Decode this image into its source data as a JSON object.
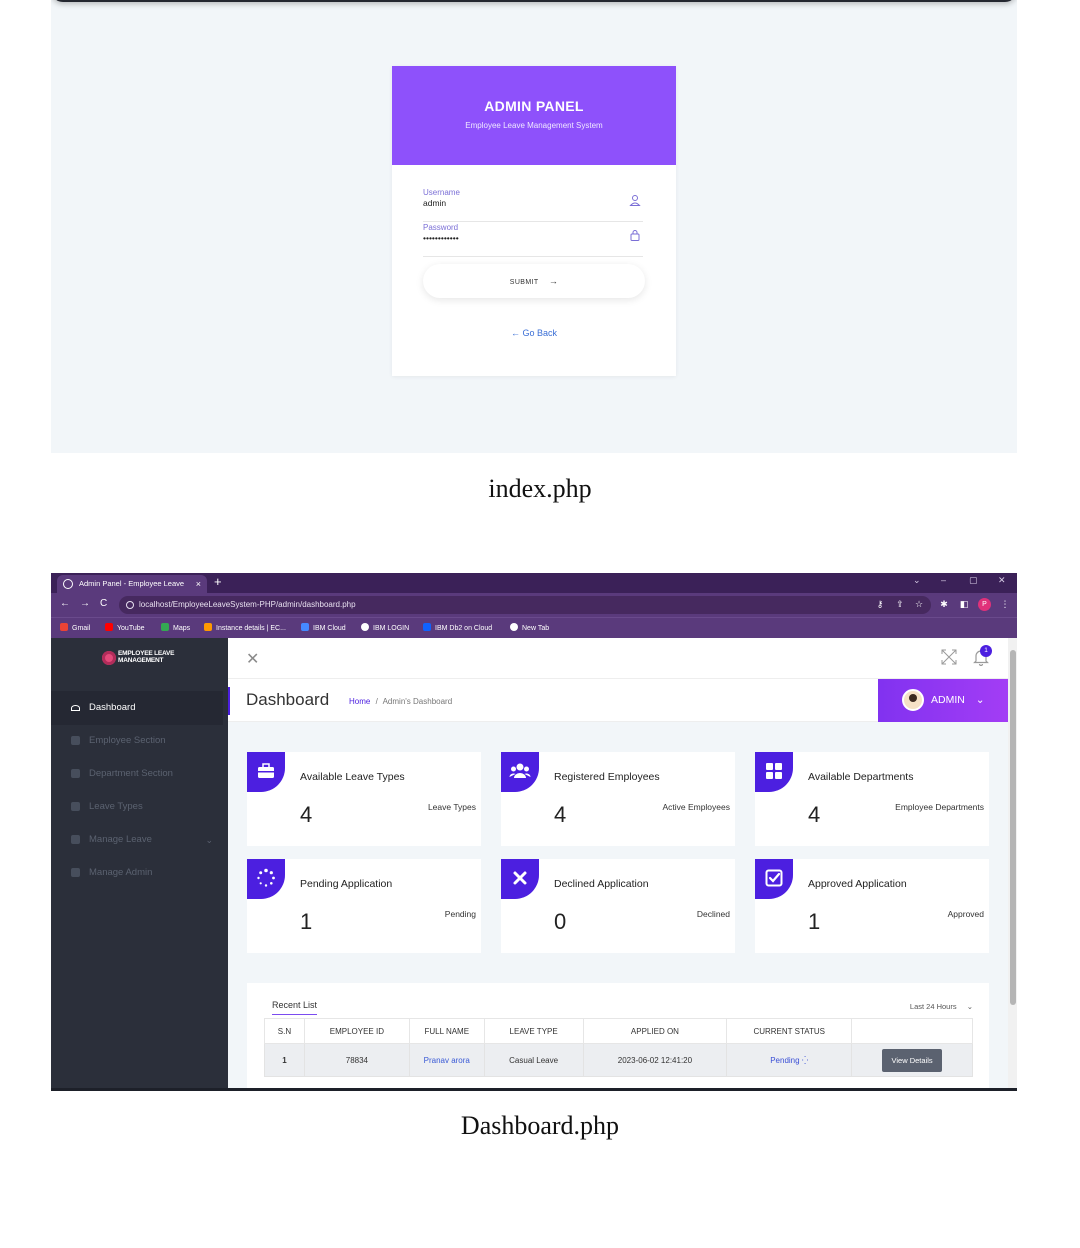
{
  "login": {
    "title": "ADMIN PANEL",
    "subtitle": "Employee Leave Management System",
    "username_label": "Username",
    "username_value": "admin",
    "password_label": "Password",
    "password_value": "••••••••••••",
    "submit_label": "SUBMIT",
    "go_back_label": "Go Back",
    "header_color": "#8e51fb"
  },
  "captions": {
    "first": "index.php",
    "second": "Dashboard.php"
  },
  "browser": {
    "tab_title": "Admin Panel - Employee Leave",
    "url": "localhost/EmployeeLeaveSystem-PHP/admin/dashboard.php",
    "profile_initial": "P",
    "bookmarks": [
      "Gmail",
      "YouTube",
      "Maps",
      "Instance details | EC...",
      "IBM Cloud",
      "IBM LOGIN",
      "IBM Db2 on Cloud",
      "New Tab"
    ],
    "theme_color": "#5a3a7c"
  },
  "sidebar": {
    "logo_line1": "EMPLOYEE LEAVE",
    "logo_line2": "MANAGEMENT",
    "items": [
      {
        "label": "Dashboard",
        "icon": "dashboard-icon",
        "active": true
      },
      {
        "label": "Employee Section",
        "icon": "id-card-icon"
      },
      {
        "label": "Department Section",
        "icon": "grid-icon"
      },
      {
        "label": "Leave Types",
        "icon": "leave-icon"
      },
      {
        "label": "Manage Leave",
        "icon": "calendar-icon"
      },
      {
        "label": "Manage Admin",
        "icon": "lock-icon"
      }
    ]
  },
  "header": {
    "page_title": "Dashboard",
    "breadcrumb_home": "Home",
    "breadcrumb_separator": "/",
    "breadcrumb_current": "Admin's Dashboard",
    "notification_count": "1",
    "user_label": "ADMIN",
    "accent_color": "#4c1fe0"
  },
  "cards": [
    {
      "title": "Available Leave Types",
      "value": "4",
      "label": "Leave Types",
      "icon": "briefcase-icon"
    },
    {
      "title": "Registered Employees",
      "value": "4",
      "label": "Active Employees",
      "icon": "users-icon"
    },
    {
      "title": "Available Departments",
      "value": "4",
      "label": "Employee Departments",
      "icon": "grid-icon"
    },
    {
      "title": "Pending Application",
      "value": "1",
      "label": "Pending",
      "icon": "spinner-icon"
    },
    {
      "title": "Declined Application",
      "value": "0",
      "label": "Declined",
      "icon": "x-icon"
    },
    {
      "title": "Approved Application",
      "value": "1",
      "label": "Approved",
      "icon": "check-square-icon"
    }
  ],
  "recent": {
    "title": "Recent List",
    "period": "Last 24 Hours",
    "columns": [
      "S.N",
      "EMPLOYEE ID",
      "FULL NAME",
      "LEAVE TYPE",
      "APPLIED ON",
      "CURRENT STATUS",
      ""
    ],
    "rows": [
      {
        "sn": "1",
        "employee_id": "78834",
        "full_name": "Pranav arora",
        "leave_type": "Casual Leave",
        "applied_on": "2023-06-02 12:41:20",
        "status": "Pending",
        "action": "View Details"
      }
    ]
  }
}
